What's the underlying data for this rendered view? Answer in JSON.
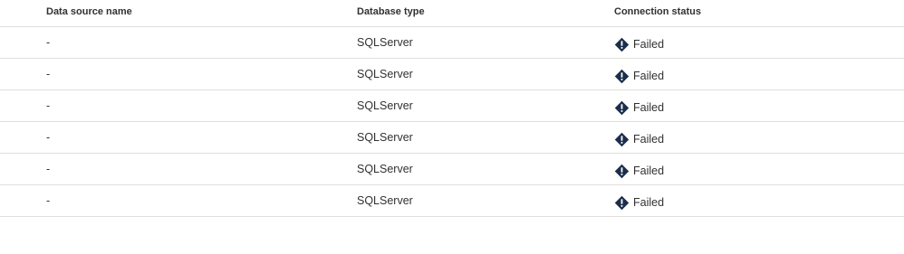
{
  "table": {
    "columns": {
      "name": "Data source name",
      "type": "Database type",
      "status": "Connection status"
    },
    "status_icon": "error-diamond-icon",
    "status_icon_color": "#1b2e4b",
    "rows": [
      {
        "name": "-",
        "type": "SQLServer",
        "status": "Failed"
      },
      {
        "name": "-",
        "type": "SQLServer",
        "status": "Failed"
      },
      {
        "name": "-",
        "type": "SQLServer",
        "status": "Failed"
      },
      {
        "name": "-",
        "type": "SQLServer",
        "status": "Failed"
      },
      {
        "name": "-",
        "type": "SQLServer",
        "status": "Failed"
      },
      {
        "name": "-",
        "type": "SQLServer",
        "status": "Failed"
      }
    ]
  }
}
